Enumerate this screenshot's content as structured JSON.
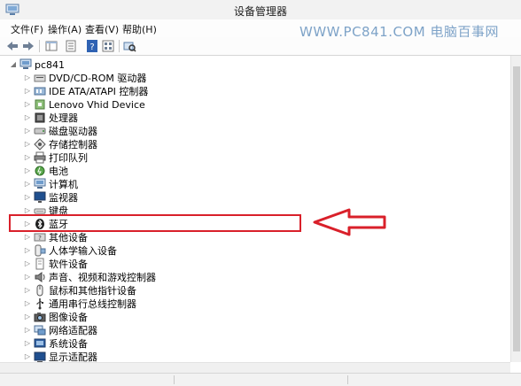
{
  "window": {
    "title": "设备管理器"
  },
  "menu": {
    "items": [
      "文件(F)",
      "操作(A)",
      "查看(V)",
      "帮助(H)"
    ]
  },
  "watermark": "WWW.PC841.COM 电脑百事网",
  "toolbar": {
    "icons": [
      "back-arrow",
      "forward-arrow",
      "show-hide-console-tree",
      "properties",
      "help",
      "show-hidden",
      "scan-hardware"
    ]
  },
  "tree": {
    "root": "pc841",
    "items": [
      {
        "label": "DVD/CD-ROM 驱动器",
        "icon": "dvd-drive"
      },
      {
        "label": "IDE ATA/ATAPI 控制器",
        "icon": "ide-controller"
      },
      {
        "label": "Lenovo Vhid Device",
        "icon": "hid-device"
      },
      {
        "label": "处理器",
        "icon": "processor"
      },
      {
        "label": "磁盘驱动器",
        "icon": "disk-drive"
      },
      {
        "label": "存储控制器",
        "icon": "storage-controller"
      },
      {
        "label": "打印队列",
        "icon": "printer"
      },
      {
        "label": "电池",
        "icon": "battery"
      },
      {
        "label": "计算机",
        "icon": "computer"
      },
      {
        "label": "监视器",
        "icon": "monitor"
      },
      {
        "label": "键盘",
        "icon": "keyboard"
      },
      {
        "label": "蓝牙",
        "icon": "bluetooth"
      },
      {
        "label": "其他设备",
        "icon": "other-device"
      },
      {
        "label": "人体学输入设备",
        "icon": "hid"
      },
      {
        "label": "软件设备",
        "icon": "software-device"
      },
      {
        "label": "声音、视频和游戏控制器",
        "icon": "sound"
      },
      {
        "label": "鼠标和其他指针设备",
        "icon": "mouse"
      },
      {
        "label": "通用串行总线控制器",
        "icon": "usb"
      },
      {
        "label": "图像设备",
        "icon": "camera"
      },
      {
        "label": "网络适配器",
        "icon": "network"
      },
      {
        "label": "系统设备",
        "icon": "system"
      },
      {
        "label": "显示适配器",
        "icon": "display"
      }
    ]
  },
  "annotation": {
    "color": "#d9202a",
    "target": "蓝牙"
  }
}
